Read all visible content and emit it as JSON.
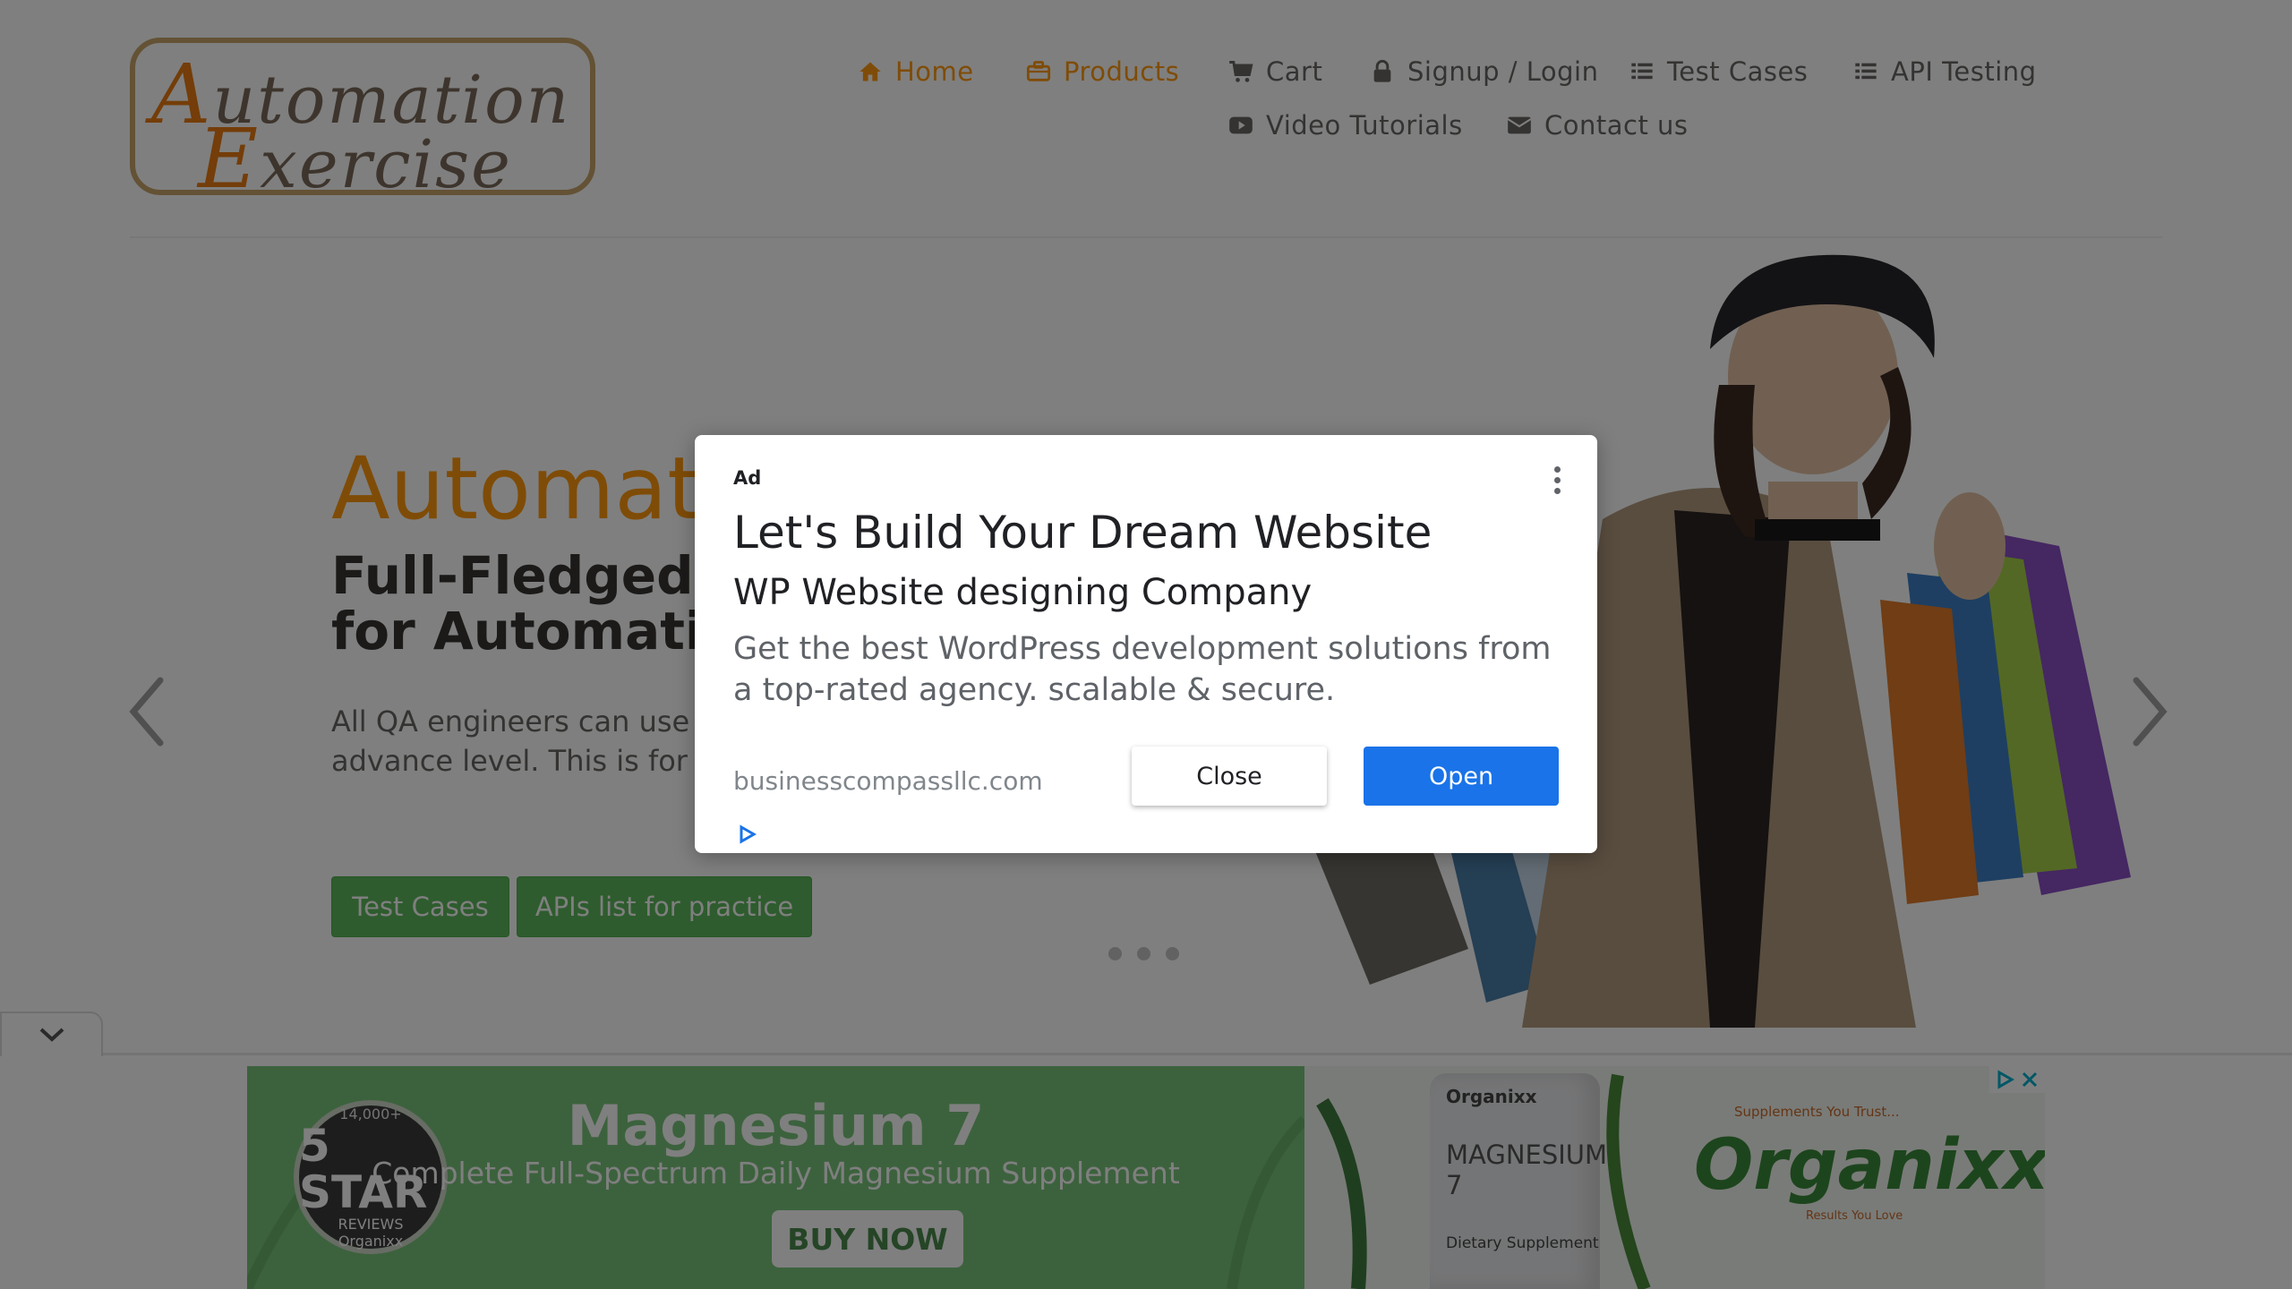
{
  "header": {
    "logo": {
      "line1_cap": "A",
      "line1_rest": "utomation",
      "line2_cap": "E",
      "line2_rest": "xercise"
    },
    "nav": [
      {
        "label": "Home",
        "icon": "home-icon",
        "active": true
      },
      {
        "label": "Products",
        "icon": "briefcase-icon",
        "active": true
      },
      {
        "label": "Cart",
        "icon": "cart-icon",
        "active": false
      },
      {
        "label": "Signup / Login",
        "icon": "lock-icon",
        "active": false
      },
      {
        "label": "Test Cases",
        "icon": "list-icon",
        "active": false
      },
      {
        "label": "API Testing",
        "icon": "list-icon",
        "active": false
      },
      {
        "label": "Video Tutorials",
        "icon": "youtube-icon",
        "active": false
      },
      {
        "label": "Contact us",
        "icon": "envelope-icon",
        "active": false
      }
    ]
  },
  "hero": {
    "title": "Automat",
    "subtitle_line1": "Full-Fledged",
    "subtitle_line2": "for Automati",
    "text": "All QA engineers can use practice and API testing e advance level. This is for their automation skills.",
    "buttons": {
      "test_cases": "Test Cases",
      "apis": "APIs list for practice"
    },
    "carousel_slides": 3
  },
  "modal": {
    "ad_label": "Ad",
    "headline": "Let's Build Your Dream Website",
    "advertiser": "WP Website designing Company",
    "body": "Get the best WordPress development solutions from a top-rated agency. scalable & secure.",
    "url": "businesscompassllc.com",
    "close_label": "Close",
    "open_label": "Open"
  },
  "banner_ad": {
    "badge_count": "14,000+",
    "badge_big": "5 STAR",
    "badge_small": "REVIEWS",
    "badge_brand": "Organixx",
    "title": "Magnesium 7",
    "subtitle": "Complete Full-Spectrum Daily Magnesium Supplement",
    "cta": "BUY NOW",
    "bottle_brand": "Organixx",
    "bottle_name": "MAGNESIUM 7",
    "bottle_text": "Dietary Supplement",
    "logo": "Organixx",
    "tagline": "Supplements You Trust...",
    "tagline2": "Results You Love"
  },
  "colors": {
    "accent": "#fe980f",
    "nav_text": "#696763",
    "button_green": "#5cb85c",
    "open_blue": "#1a73e8",
    "banner_green": "#79c57a"
  }
}
